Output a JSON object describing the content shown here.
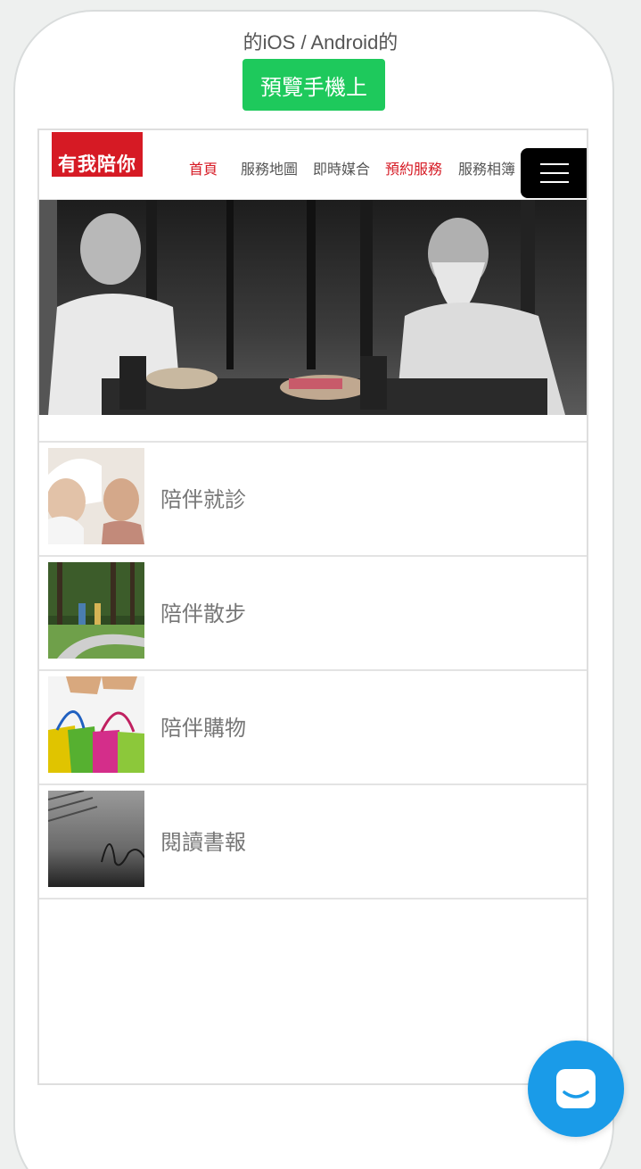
{
  "preview": {
    "title": "的iOS / Android的",
    "button_label": "預覽手機上"
  },
  "site": {
    "logo_text": "有我陪你",
    "nav": [
      {
        "label": "首頁",
        "state": "active"
      },
      {
        "label": "服務地圖",
        "state": "normal"
      },
      {
        "label": "即時媒合",
        "state": "normal"
      },
      {
        "label": "預約服務",
        "state": "highlight"
      },
      {
        "label": "服務相簿",
        "state": "normal"
      }
    ],
    "menu_icon": "hamburger-menu-icon"
  },
  "services": [
    {
      "label": "陪伴就診",
      "thumb": "nurse-with-elder"
    },
    {
      "label": "陪伴散步",
      "thumb": "walking-in-park"
    },
    {
      "label": "陪伴購物",
      "thumb": "shopping-bags"
    },
    {
      "label": "閱讀書報",
      "thumb": "document-signature"
    }
  ],
  "colors": {
    "brand_red": "#d61a24",
    "preview_green": "#1ec95c",
    "chat_blue": "#1a9be8"
  },
  "chat": {
    "icon": "chat-launcher-icon"
  }
}
